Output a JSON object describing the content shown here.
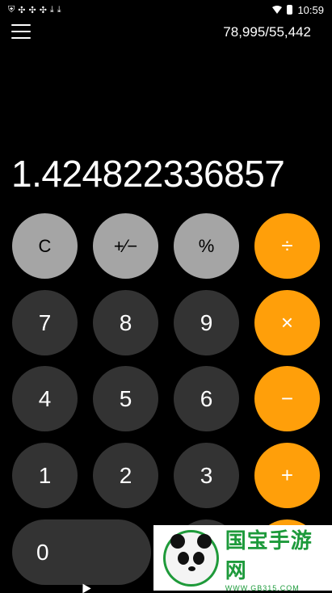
{
  "status_bar": {
    "time": "10:59",
    "left_icons": [
      "shield-icon",
      "android-debug-icon",
      "android-debug-icon",
      "android-debug-icon",
      "download-icon",
      "download-icon"
    ]
  },
  "header": {
    "fraction": "78,995/55,442"
  },
  "display": {
    "value": "1.424822336857"
  },
  "keys": {
    "clear": "C",
    "sign": "+⁄−",
    "percent": "%",
    "divide": "÷",
    "seven": "7",
    "eight": "8",
    "nine": "9",
    "multiply": "×",
    "four": "4",
    "five": "5",
    "six": "6",
    "minus": "−",
    "one": "1",
    "two": "2",
    "three": "3",
    "plus": "+",
    "zero": "0"
  },
  "watermark": {
    "title": "国宝手游网",
    "url": "WWW.GB315.COM"
  },
  "colors": {
    "background": "#000000",
    "function_key": "#a5a5a5",
    "number_key": "#333333",
    "operator_key": "#ff9f0a",
    "watermark_green": "#1d9a3b"
  }
}
